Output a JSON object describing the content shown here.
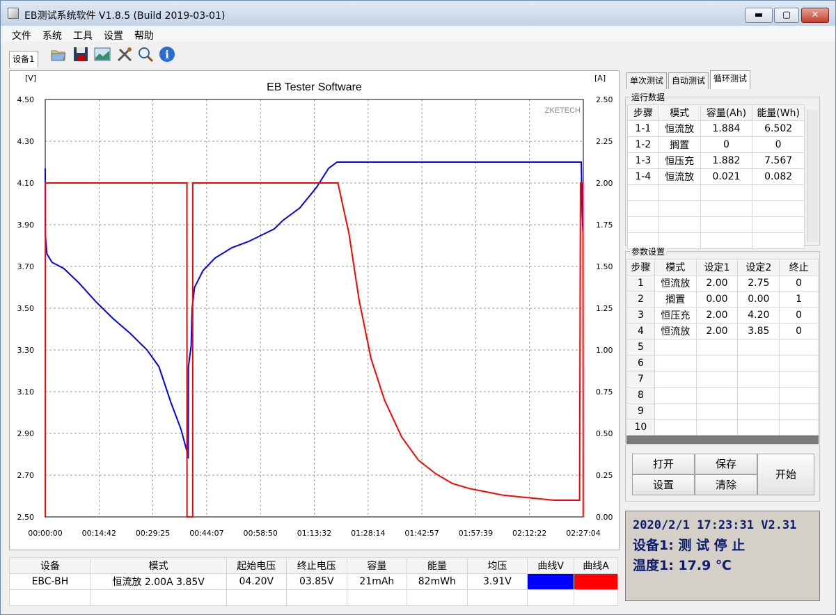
{
  "window": {
    "title": "EB测试系统软件 V1.8.5 (Build 2019-03-01)",
    "min": "▬",
    "max": "▢",
    "close": "✕"
  },
  "menu": [
    "文件",
    "系统",
    "工具",
    "设置",
    "帮助"
  ],
  "toolbar": {
    "device_tab": "设备1",
    "icons": [
      "open-folder-icon",
      "save-disk-icon",
      "chart-image-icon",
      "tools-icon",
      "search-icon",
      "info-icon"
    ]
  },
  "chart_data": {
    "type": "line",
    "title": "EB Tester Software",
    "watermark": "ZKETECH",
    "ylabel_left": "[V]",
    "ylabel_right": "[A]",
    "ylim_left": [
      2.5,
      4.5
    ],
    "ylim_right": [
      0,
      2.5
    ],
    "yticks_left": [
      "4.50",
      "4.30",
      "4.10",
      "3.90",
      "3.70",
      "3.50",
      "3.30",
      "3.10",
      "2.90",
      "2.70",
      "2.50"
    ],
    "yticks_right": [
      "2.50",
      "2.25",
      "2.00",
      "1.75",
      "1.50",
      "1.25",
      "1.00",
      "0.75",
      "0.50",
      "0.25",
      "0.00"
    ],
    "xticks": [
      "00:00:00",
      "00:14:42",
      "00:29:25",
      "00:44:07",
      "00:58:50",
      "01:13:32",
      "01:28:14",
      "01:42:57",
      "01:57:39",
      "02:12:22",
      "02:27:04"
    ],
    "xmax_seconds": 8824,
    "series": [
      {
        "color": "#0000ff",
        "axis": "left",
        "points": [
          [
            0,
            4.17
          ],
          [
            10,
            3.85
          ],
          [
            100,
            3.76
          ],
          [
            400,
            3.72
          ],
          [
            1100,
            3.69
          ],
          [
            2000,
            3.62
          ],
          [
            3000,
            3.53
          ],
          [
            4000,
            3.45
          ],
          [
            5000,
            3.38
          ],
          [
            6000,
            3.3
          ],
          [
            6700,
            3.22
          ],
          [
            7400,
            3.05
          ],
          [
            8000,
            2.92
          ],
          [
            8400,
            2.8
          ],
          [
            8430,
            2.78
          ],
          [
            8440,
            3.22
          ],
          [
            8600,
            3.32
          ],
          [
            8640,
            3.45
          ],
          [
            8660,
            3.5
          ],
          [
            8800,
            3.6
          ],
          [
            9300,
            3.68
          ],
          [
            10000,
            3.74
          ],
          [
            11000,
            3.79
          ],
          [
            12000,
            3.82
          ],
          [
            13000,
            3.86
          ],
          [
            13500,
            3.88
          ],
          [
            14000,
            3.92
          ],
          [
            15000,
            3.98
          ],
          [
            15600,
            4.04
          ],
          [
            16000,
            4.08
          ],
          [
            16700,
            4.17
          ],
          [
            17200,
            4.2
          ],
          [
            31600,
            4.2
          ],
          [
            31650,
            3.95
          ],
          [
            31700,
            3.86
          ]
        ]
      },
      {
        "color": "#ff0000",
        "axis": "right",
        "points": [
          [
            0,
            0
          ],
          [
            5,
            0
          ],
          [
            10,
            2.0
          ],
          [
            7000,
            2.0
          ],
          [
            8350,
            2.0
          ],
          [
            8355,
            0
          ],
          [
            8690,
            0
          ],
          [
            8695,
            2.0
          ],
          [
            17250,
            2.0
          ],
          [
            17900,
            1.7
          ],
          [
            18500,
            1.3
          ],
          [
            19200,
            0.95
          ],
          [
            20000,
            0.7
          ],
          [
            21000,
            0.48
          ],
          [
            22000,
            0.34
          ],
          [
            23000,
            0.26
          ],
          [
            24000,
            0.2
          ],
          [
            25000,
            0.17
          ],
          [
            26000,
            0.15
          ],
          [
            27000,
            0.13
          ],
          [
            28000,
            0.12
          ],
          [
            29000,
            0.11
          ],
          [
            30000,
            0.1
          ],
          [
            31500,
            0.1
          ],
          [
            31550,
            2.0
          ],
          [
            31700,
            2.0
          ],
          [
            31710,
            0
          ]
        ]
      }
    ]
  },
  "right": {
    "tabs": [
      "单次测试",
      "自动测试",
      "循环测试"
    ],
    "run": {
      "legend": "运行数据",
      "headers": [
        "步骤",
        "模式",
        "容量(Ah)",
        "能量(Wh)"
      ],
      "rows": [
        [
          "1-1",
          "恒流放",
          "1.884",
          "6.502"
        ],
        [
          "1-2",
          "搁置",
          "0",
          "0"
        ],
        [
          "1-3",
          "恒压充",
          "1.882",
          "7.567"
        ],
        [
          "1-4",
          "恒流放",
          "0.021",
          "0.082"
        ],
        [
          "",
          "",
          "",
          ""
        ],
        [
          "",
          "",
          "",
          ""
        ],
        [
          "",
          "",
          "",
          ""
        ],
        [
          "",
          "",
          "",
          ""
        ]
      ]
    },
    "params": {
      "legend": "参数设置",
      "headers": [
        "步骤",
        "模式",
        "设定1",
        "设定2",
        "终止"
      ],
      "rows": [
        [
          "1",
          "恒流放",
          "2.00",
          "2.75",
          "0"
        ],
        [
          "2",
          "搁置",
          "0.00",
          "0.00",
          "1"
        ],
        [
          "3",
          "恒压充",
          "2.00",
          "4.20",
          "0"
        ],
        [
          "4",
          "恒流放",
          "2.00",
          "3.85",
          "0"
        ],
        [
          "5",
          "",
          "",
          "",
          ""
        ],
        [
          "6",
          "",
          "",
          "",
          ""
        ],
        [
          "7",
          "",
          "",
          "",
          ""
        ],
        [
          "8",
          "",
          "",
          "",
          ""
        ],
        [
          "9",
          "",
          "",
          "",
          ""
        ],
        [
          "10",
          "",
          "",
          "",
          ""
        ]
      ]
    },
    "buttons": {
      "open": "打开",
      "save": "保存",
      "start": "开始",
      "settings": "设置",
      "clear": "清除"
    },
    "status": {
      "line1": "2020/2/1 17:23:31  V2.31",
      "line2": "设备1: 测 试 停 止",
      "line3": "温度1: 17.9 ℃"
    }
  },
  "bottom": {
    "headers": [
      "设备",
      "模式",
      "起始电压",
      "终止电压",
      "容量",
      "能量",
      "均压",
      "曲线V",
      "曲线A"
    ],
    "row": [
      "EBC-BH",
      "恒流放  2.00A  3.85V",
      "04.20V",
      "03.85V",
      "21mAh",
      "82mWh",
      "3.91V"
    ],
    "curve_v_color": "#0000ff",
    "curve_a_color": "#ff0000"
  }
}
